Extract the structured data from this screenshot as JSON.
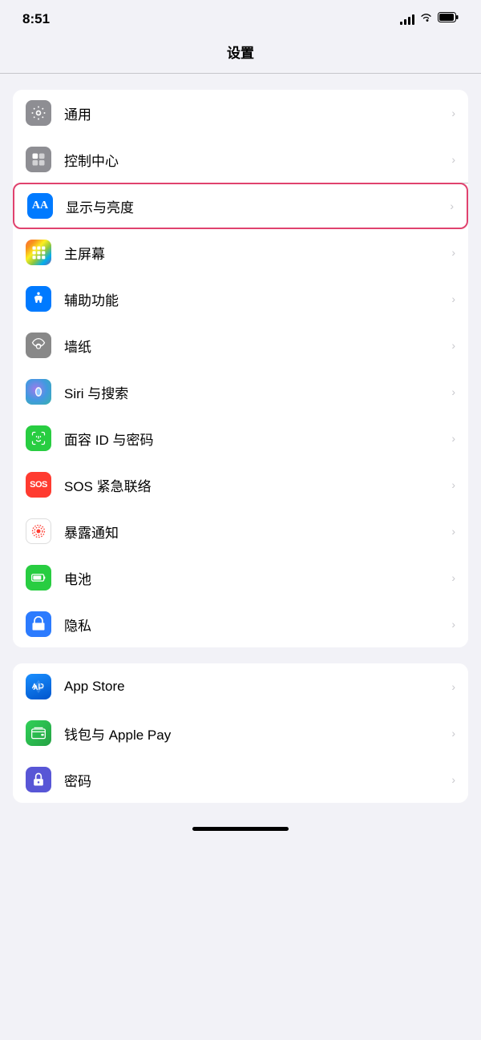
{
  "statusBar": {
    "time": "8:51",
    "signalLabel": "signal",
    "wifiLabel": "wifi",
    "batteryLabel": "battery"
  },
  "pageTitle": "设置",
  "group1": {
    "items": [
      {
        "id": "general",
        "label": "通用",
        "iconBg": "icon-gray",
        "iconType": "gear",
        "highlighted": false
      },
      {
        "id": "control-center",
        "label": "控制中心",
        "iconBg": "icon-gray2",
        "iconType": "toggle",
        "highlighted": false
      },
      {
        "id": "display",
        "label": "显示与亮度",
        "iconBg": "icon-blue",
        "iconType": "aa",
        "highlighted": true
      },
      {
        "id": "home-screen",
        "label": "主屏幕",
        "iconBg": "icon-multicolor",
        "iconType": "grid",
        "highlighted": false
      },
      {
        "id": "accessibility",
        "label": "辅助功能",
        "iconBg": "icon-blue2",
        "iconType": "accessibility",
        "highlighted": false
      },
      {
        "id": "wallpaper",
        "label": "墙纸",
        "iconBg": "icon-flower",
        "iconType": "flower",
        "highlighted": false
      },
      {
        "id": "siri",
        "label": "Siri 与搜索",
        "iconBg": "icon-siri",
        "iconType": "siri",
        "highlighted": false
      },
      {
        "id": "faceid",
        "label": "面容 ID 与密码",
        "iconBg": "icon-faceid",
        "iconType": "faceid",
        "highlighted": false
      },
      {
        "id": "sos",
        "label": "SOS 紧急联络",
        "iconBg": "icon-sos",
        "iconType": "sos",
        "highlighted": false
      },
      {
        "id": "exposure",
        "label": "暴露通知",
        "iconBg": "icon-exposure",
        "iconType": "exposure",
        "highlighted": false
      },
      {
        "id": "battery",
        "label": "电池",
        "iconBg": "icon-battery",
        "iconType": "battery",
        "highlighted": false
      },
      {
        "id": "privacy",
        "label": "隐私",
        "iconBg": "icon-privacy",
        "iconType": "privacy",
        "highlighted": false
      }
    ]
  },
  "group2": {
    "items": [
      {
        "id": "appstore",
        "label": "App Store",
        "iconBg": "icon-appstore",
        "iconType": "appstore",
        "highlighted": false
      },
      {
        "id": "wallet",
        "label": "钱包与 Apple Pay",
        "iconBg": "icon-wallet",
        "iconType": "wallet",
        "highlighted": false
      },
      {
        "id": "password",
        "label": "密码",
        "iconBg": "icon-password",
        "iconType": "password",
        "highlighted": false
      }
    ]
  },
  "chevron": "›"
}
